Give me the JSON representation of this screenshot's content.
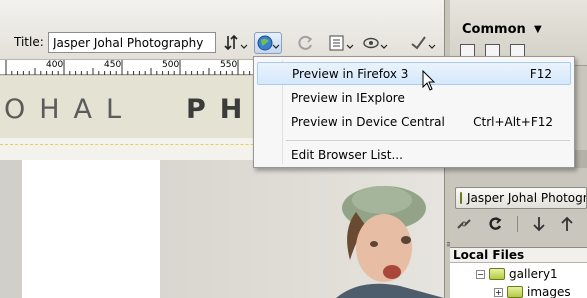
{
  "toolbar": {
    "title_label": "Title:",
    "title_value": "Jasper Johal Photography",
    "icons": [
      "file-management-icon",
      "preview-browser-icon",
      "refresh-icon",
      "view-options-icon",
      "visual-aids-icon",
      "validate-icon"
    ]
  },
  "ruler": {
    "marks": [
      "400",
      "450",
      "500",
      "550"
    ]
  },
  "canvas": {
    "logo_left": "OHAL",
    "logo_right": "PH"
  },
  "insert_panel": {
    "category": "Common",
    "arrow": "▼"
  },
  "files_panel": {
    "site_name": "Jasper Johal Photography",
    "local_files_label": "Local Files",
    "tree": [
      {
        "label": "gallery1",
        "expander": "−"
      },
      {
        "label": "images",
        "expander": "+"
      }
    ]
  },
  "preview_menu": {
    "items": [
      {
        "label": "Preview in Firefox 3",
        "shortcut": "F12",
        "highlighted": true
      },
      {
        "label": "Preview in IExplore",
        "shortcut": ""
      },
      {
        "label": "Preview in Device Central",
        "shortcut": "Ctrl+Alt+F12"
      },
      {
        "label": "Edit Browser List...",
        "shortcut": ""
      }
    ]
  },
  "colors": {
    "highlight_border": "#a8cdf2",
    "folder": "#b6c942"
  }
}
